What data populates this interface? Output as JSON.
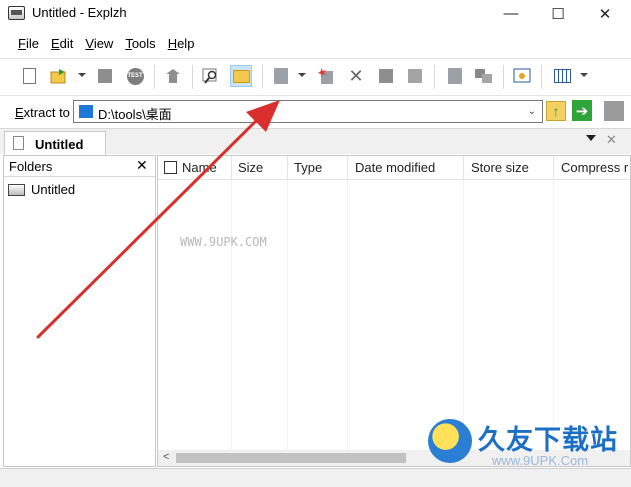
{
  "window": {
    "title": "Untitled - Explzh",
    "minimize_glyph": "—",
    "maximize_glyph": "☐",
    "close_glyph": "✕"
  },
  "menu": [
    {
      "accel": "F",
      "rest": "ile"
    },
    {
      "accel": "E",
      "rest": "dit"
    },
    {
      "accel": "V",
      "rest": "iew"
    },
    {
      "accel": "T",
      "rest": "ools"
    },
    {
      "accel": "H",
      "rest": "elp"
    }
  ],
  "toolbar": {
    "icons": [
      "new-archive-icon",
      "open-icon",
      "save-icon",
      "test-icon",
      "extract-icon",
      "find-icon",
      "folder-open-icon",
      "add-icon",
      "add-new-icon",
      "delete-icon",
      "copy-icon",
      "settings-icon",
      "move-icon",
      "split-icon",
      "image-icon",
      "view-icon"
    ],
    "test_badge": "TEST",
    "delete_glyph": "✕"
  },
  "extract": {
    "label_accel": "E",
    "label_rest": "xtract to",
    "path": "D:\\tools\\桌面",
    "dropdown_glyph": "⌄",
    "up_glyph": "↑",
    "go_glyph": "➔"
  },
  "tab": {
    "label": "Untitled",
    "close_glyph": "✕"
  },
  "folders": {
    "title": "Folders",
    "close_glyph": "✕",
    "items": [
      "Untitled"
    ]
  },
  "filelist": {
    "columns": [
      "Name",
      "Size",
      "Type",
      "Date modified",
      "Store size",
      "Compress r"
    ],
    "watermark": "WWW.9UPK.COM",
    "scroll_left_glyph": "<"
  },
  "logo": {
    "name": "久友下载站",
    "url": "www.9UPK.Com"
  },
  "colors": {
    "accent": "#cce4f7",
    "arrow": "#d9302e",
    "logo": "#1b6fc6"
  }
}
